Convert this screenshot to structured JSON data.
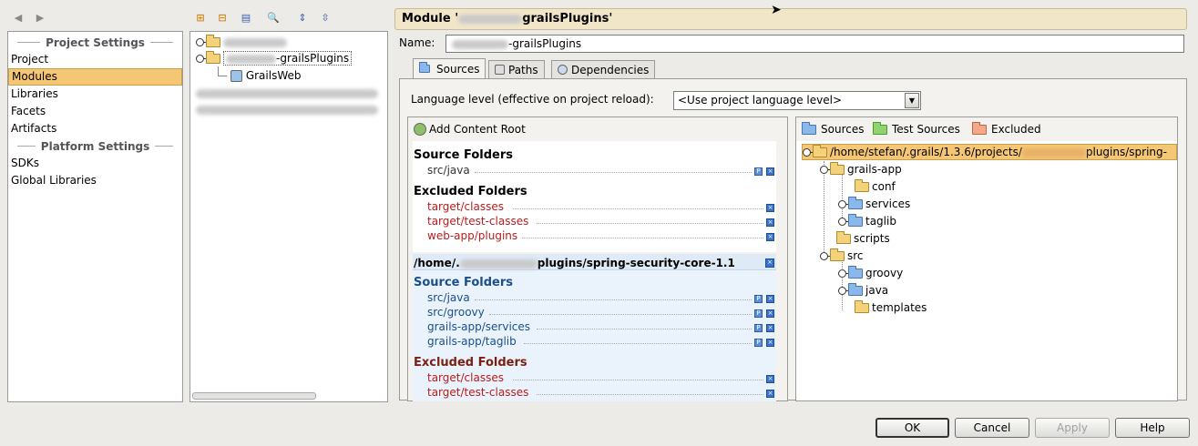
{
  "toolbar_left": {
    "back_icon": "arrow-left-icon",
    "forward_icon": "arrow-right-icon"
  },
  "nav": {
    "project_settings_header": "Project Settings",
    "platform_settings_header": "Platform Settings",
    "items_project": [
      "Project",
      "Modules",
      "Libraries",
      "Facets",
      "Artifacts"
    ],
    "items_platform": [
      "SDKs",
      "Global Libraries"
    ],
    "selected": "Modules"
  },
  "module_tree": {
    "toolbar_icons": [
      "add-icon",
      "remove-icon",
      "copy-icon",
      "find-icon",
      "expand-all-icon",
      "collapse-all-icon"
    ],
    "rows": [
      {
        "label": "",
        "blurred": true
      },
      {
        "label": "-grailsPlugins",
        "blurred_prefix": true
      },
      {
        "label": "GrailsWeb"
      }
    ]
  },
  "module": {
    "title": "Module '",
    "title_suffix": "grailsPlugins'",
    "name_label": "Name:",
    "name_value": "-grailsPlugins",
    "tabs": [
      "Sources",
      "Paths",
      "Dependencies"
    ],
    "active_tab": "Sources",
    "language_level_label": "Language level (effective on project reload):",
    "language_level_value": "<Use project language level>"
  },
  "content_roots": {
    "add_label": "Add Content Root",
    "root1": {
      "source_folders_title": "Source Folders",
      "source_folders": [
        "src/java"
      ],
      "excluded_folders_title": "Excluded Folders",
      "excluded_folders": [
        "target/classes",
        "target/test-classes",
        "web-app/plugins"
      ]
    },
    "root2": {
      "path_prefix": "/home/.",
      "path_suffix": "plugins/spring-security-core-1.1",
      "source_folders_title": "Source Folders",
      "source_folders": [
        "src/java",
        "src/groovy",
        "grails-app/services",
        "grails-app/taglib"
      ],
      "excluded_folders_title": "Excluded Folders",
      "excluded_folders": [
        "target/classes",
        "target/test-classes"
      ]
    }
  },
  "folder_tree": {
    "toggles": {
      "sources": "Sources",
      "test_sources": "Test Sources",
      "excluded": "Excluded"
    },
    "root_prefix": "/home/stefan/.grails/1.3.6/projects/",
    "root_suffix": "plugins/spring-",
    "nodes": [
      "grails-app",
      "conf",
      "services",
      "taglib",
      "scripts",
      "src",
      "groovy",
      "java",
      "templates"
    ]
  },
  "buttons": {
    "ok": "OK",
    "cancel": "Cancel",
    "apply": "Apply",
    "help": "Help"
  },
  "colors": {
    "selection": "#f5c774",
    "excluded_text": "#b71c1c",
    "source_text": "#1a4f8a"
  }
}
